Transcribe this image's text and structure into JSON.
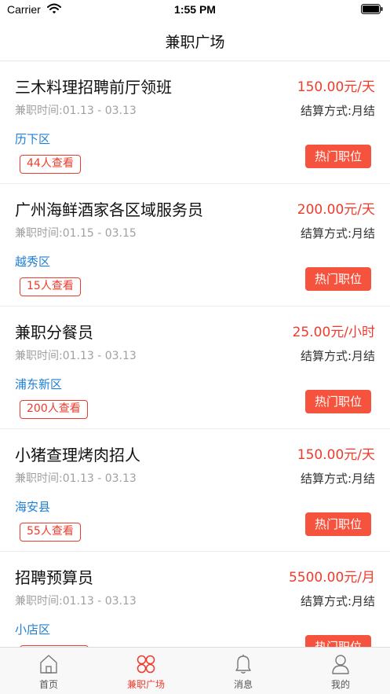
{
  "status_bar": {
    "carrier": "Carrier",
    "time": "1:55 PM"
  },
  "nav": {
    "title": "兼职广场"
  },
  "colors": {
    "accent_red": "#ef3b2c",
    "hot_button_bg": "#f5533d",
    "district_blue": "#1e7fd6",
    "muted_gray": "#a0a0a0"
  },
  "jobs": [
    {
      "title": "三木料理招聘前厅领班",
      "salary": "150.00元/天",
      "period": "兼职时间:01.13 - 03.13",
      "settlement": "结算方式:月结",
      "district": "历下区",
      "views": "44人查看",
      "tag": "热门职位"
    },
    {
      "title": "广州海鲜酒家各区域服务员",
      "salary": "200.00元/天",
      "period": "兼职时间:01.15 - 03.15",
      "settlement": "结算方式:月结",
      "district": "越秀区",
      "views": "15人查看",
      "tag": "热门职位"
    },
    {
      "title": "兼职分餐员",
      "salary": "25.00元/小时",
      "period": "兼职时间:01.13 - 03.13",
      "settlement": "结算方式:月结",
      "district": "浦东新区",
      "views": "200人查看",
      "tag": "热门职位"
    },
    {
      "title": "小猪查理烤肉招人",
      "salary": "150.00元/天",
      "period": "兼职时间:01.13 - 03.13",
      "settlement": "结算方式:月结",
      "district": "海安县",
      "views": "55人查看",
      "tag": "热门职位"
    },
    {
      "title": "招聘预算员",
      "salary": "5500.00元/月",
      "period": "兼职时间:01.13 - 03.13",
      "settlement": "结算方式:月结",
      "district": "小店区",
      "views": "",
      "tag": "热门职位"
    }
  ],
  "tabs": [
    {
      "label": "首页",
      "icon": "home-icon",
      "active": false
    },
    {
      "label": "兼职广场",
      "icon": "grid-circles-icon",
      "active": true
    },
    {
      "label": "消息",
      "icon": "bell-icon",
      "active": false
    },
    {
      "label": "我的",
      "icon": "user-icon",
      "active": false
    }
  ]
}
